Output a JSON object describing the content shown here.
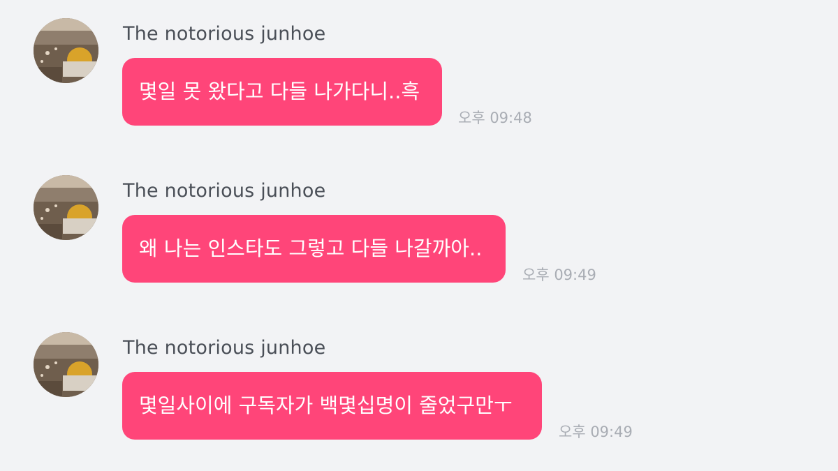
{
  "messages": [
    {
      "sender": "The notorious junhoe",
      "text": "몇일 못 왔다고 다들 나가다니..흑",
      "time": "오후 09:48"
    },
    {
      "sender": "The notorious junhoe",
      "text": "왜 나는 인스타도 그렇고 다들 나갈까아..",
      "time": "오후 09:49"
    },
    {
      "sender": "The notorious junhoe",
      "text": "몇일사이에 구독자가 백몇십명이 줄었구만ㅜ",
      "time": "오후 09:49"
    }
  ],
  "colors": {
    "background": "#f2f3f5",
    "bubble": "#ff4579",
    "bubble_text": "#ffffff",
    "sender_text": "#4a4f57",
    "time_text": "#a9adb4"
  }
}
